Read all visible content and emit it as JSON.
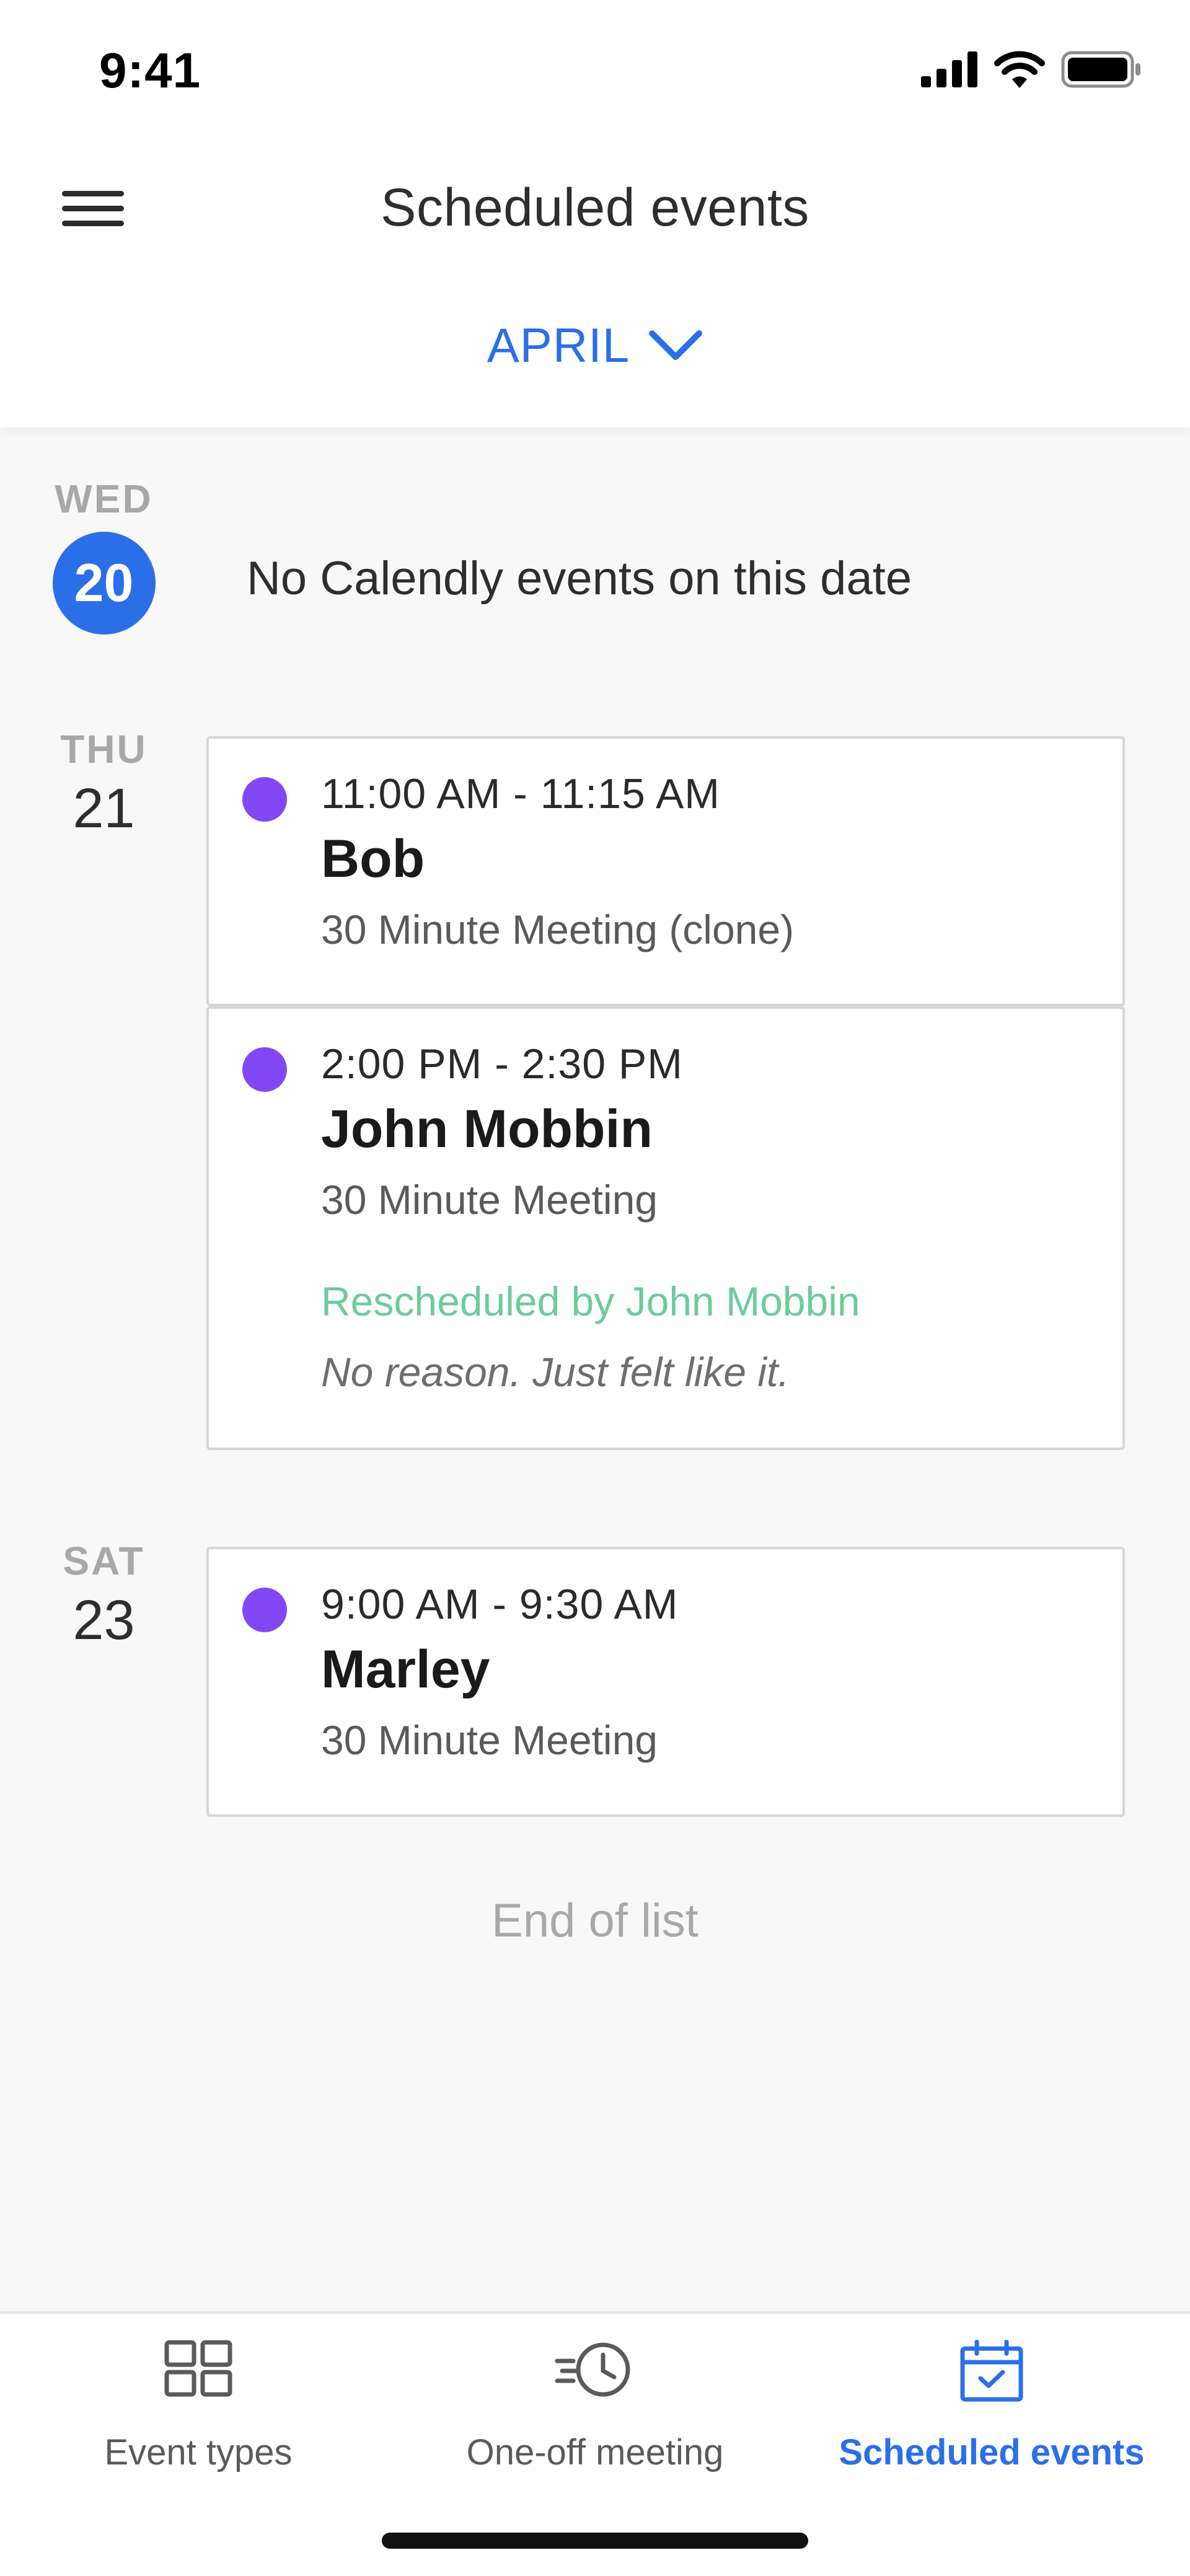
{
  "status_bar": {
    "time": "9:41",
    "icons": [
      "signal-icon",
      "wifi-icon",
      "battery-icon"
    ]
  },
  "header": {
    "menu_icon": "hamburger-menu-icon",
    "title": "Scheduled events",
    "month": "APRIL",
    "month_icon": "chevron-down-icon"
  },
  "days": [
    {
      "dow": "WED",
      "date": "20",
      "is_today": true,
      "empty_message": "No Calendly events on this date"
    },
    {
      "dow": "THU",
      "date": "21",
      "events": [
        {
          "time": "11:00 AM - 11:15 AM",
          "name": "Bob",
          "type": "30 Minute Meeting (clone)"
        },
        {
          "time": "2:00 PM - 2:30 PM",
          "name": "John Mobbin",
          "type": "30 Minute Meeting",
          "reschedule_note": "Rescheduled by John Mobbin",
          "reschedule_reason": "No reason. Just felt like it."
        }
      ]
    },
    {
      "dow": "SAT",
      "date": "23",
      "events": [
        {
          "time": "9:00 AM - 9:30 AM",
          "name": "Marley",
          "type": "30 Minute Meeting"
        }
      ]
    }
  ],
  "end_of_list": "End of list",
  "bottom_nav": {
    "items": [
      {
        "label": "Event types",
        "icon": "grid-icon",
        "active": false
      },
      {
        "label": "One-off meeting",
        "icon": "clock-arrows-icon",
        "active": false
      },
      {
        "label": "Scheduled events",
        "icon": "calendar-check-icon",
        "active": true
      }
    ]
  },
  "colors": {
    "accent": "#2b6fe8",
    "event_dot": "#8247f5",
    "reschedule_note": "#6ccc9a",
    "background": "#f8f8f8"
  }
}
